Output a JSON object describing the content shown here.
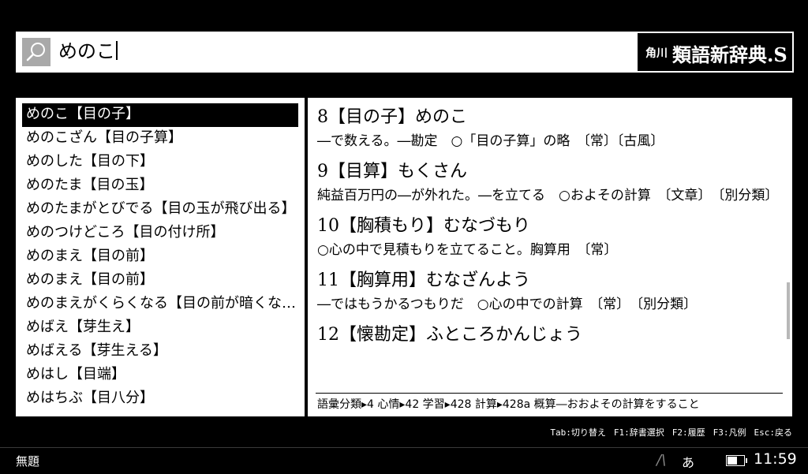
{
  "search": {
    "query": "めのこ"
  },
  "dictionary": {
    "publisher": "角川",
    "name": "類語新辞典.S"
  },
  "word_list": [
    "めのこ【目の子】",
    "めのこざん【目の子算】",
    "めのした【目の下】",
    "めのたま【目の玉】",
    "めのたまがとびでる【目の玉が飛び出る】",
    "めのつけどころ【目の付け所】",
    "めのまえ【目の前】",
    "めのまえ【目の前】",
    "めのまえがくらくなる【目の前が暗くなる】",
    "めばえ【芽生え】",
    "めばえる【芽生える】",
    "めはし【目端】",
    "めはちぶ【目八分】"
  ],
  "selected_index": 0,
  "entries": [
    {
      "head": "8【目の子】めのこ",
      "body": "―で数える。―勘定　○「目の子算」の略　〔常〕〔古風〕"
    },
    {
      "head": "9【目算】もくさん",
      "body": "純益百万円の―が外れた。―を立てる　○およその計算　〔文章〕　〔別分類〕"
    },
    {
      "head": "10【胸積もり】むなづもり",
      "body": "○心の中で見積もりを立てること。胸算用　〔常〕"
    },
    {
      "head": "11【胸算用】むなざんよう",
      "body": "―ではもうかるつもりだ　○心の中での計算　〔常〕　〔別分類〕"
    },
    {
      "head": "12【懐勘定】ふところかんじょう",
      "body": ""
    }
  ],
  "classification": "語彙分類▸4 心情▸42 学習▸428 計算▸428a 概算―おおよその計算をすること",
  "shortcuts": [
    "Tab:切り替え",
    "F1:辞書選択",
    "F2:履歴",
    "F3:凡例",
    "Esc:戻る"
  ],
  "status": {
    "title": "無題",
    "ime_mode": "あ",
    "clock": "11:59",
    "battery_level": 0.6
  },
  "icons": {
    "search": "search-icon",
    "ime": "ime-indicator-icon",
    "battery": "battery-icon"
  }
}
